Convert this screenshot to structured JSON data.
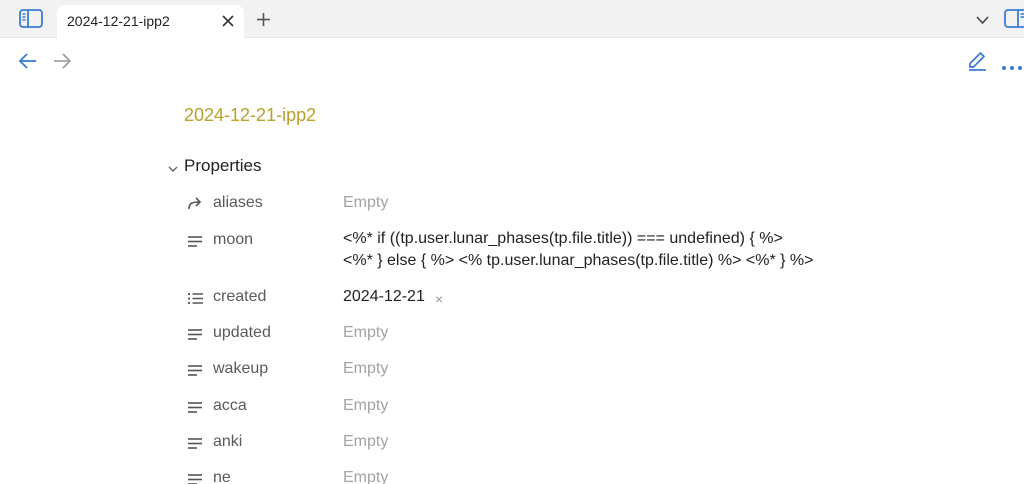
{
  "tabbar": {
    "active_tab_title": "2024-12-21-ipp2"
  },
  "document": {
    "title": "2024-12-21-ipp2",
    "properties_heading": "Properties",
    "properties": [
      {
        "key": "aliases",
        "icon": "alias-arrow-icon",
        "value": "Empty",
        "empty": true
      },
      {
        "key": "moon",
        "icon": "text-lines-icon",
        "value_line1": "<%* if ((tp.user.lunar_phases(tp.file.title)) === undefined) { %>",
        "value_line2": "<%* } else { %> <% tp.user.lunar_phases(tp.file.title) %> <%* } %>",
        "empty": false
      },
      {
        "key": "created",
        "icon": "list-icon",
        "value": "2024-12-21",
        "remove_glyph": "×",
        "empty": false
      },
      {
        "key": "updated",
        "icon": "text-lines-icon",
        "value": "Empty",
        "empty": true
      },
      {
        "key": "wakeup",
        "icon": "text-lines-icon",
        "value": "Empty",
        "empty": true
      },
      {
        "key": "acca",
        "icon": "text-lines-icon",
        "value": "Empty",
        "empty": true
      },
      {
        "key": "anki",
        "icon": "text-lines-icon",
        "value": "Empty",
        "empty": true
      },
      {
        "key": "ne",
        "icon": "text-lines-icon",
        "value": "Empty",
        "empty": true
      }
    ]
  },
  "colors": {
    "accent": "#3a7bd5",
    "title": "#b8a02a",
    "empty_value": "#a3a3a3"
  }
}
